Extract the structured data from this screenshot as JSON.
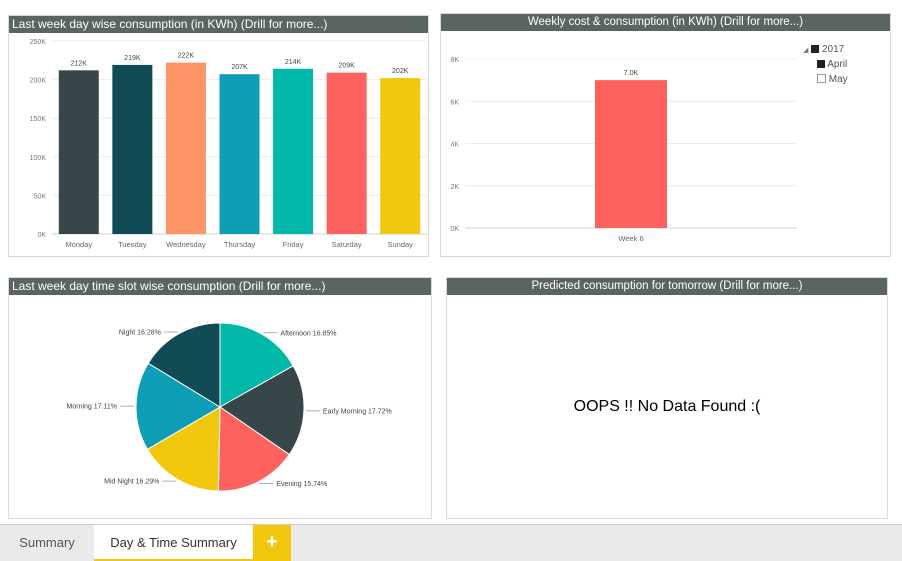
{
  "tiles": {
    "day_wise": {
      "title": "Last week day wise consumption (in KWh) (Drill for more...)",
      "chart_data": {
        "type": "bar",
        "categories": [
          "Monday",
          "Tuesday",
          "Wednesday",
          "Thursday",
          "Friday",
          "Saturday",
          "Sunday"
        ],
        "values": [
          212000,
          219000,
          222000,
          207000,
          214000,
          209000,
          202000
        ],
        "data_labels": [
          "212K",
          "219K",
          "222K",
          "207K",
          "214K",
          "209K",
          "202K"
        ],
        "colors": [
          "#374649",
          "#114b56",
          "#fd9567",
          "#0d9eb5",
          "#01b8aa",
          "#fd625e",
          "#f2c80f"
        ],
        "ylim": [
          0,
          250000
        ],
        "yticks": [
          0,
          50000,
          100000,
          150000,
          200000,
          250000
        ],
        "ytick_labels": [
          "0K",
          "50K",
          "100K",
          "150K",
          "200K",
          "250K"
        ],
        "grid": true
      }
    },
    "weekly_cost": {
      "title": "Weekly cost & consumption (in KWh) (Drill for more...)",
      "chart_data": {
        "type": "bar",
        "categories": [
          "Week 6"
        ],
        "values": [
          7000
        ],
        "data_labels": [
          "7.0K"
        ],
        "colors": [
          "#fd625e"
        ],
        "ylim": [
          0,
          8000
        ],
        "yticks": [
          0,
          2000,
          4000,
          6000,
          8000
        ],
        "ytick_labels": [
          "0K",
          "2K",
          "4K",
          "6K",
          "8K"
        ],
        "grid": true
      },
      "legend": {
        "year": "2017",
        "items": [
          {
            "label": "April",
            "checked": true
          },
          {
            "label": "May",
            "checked": false
          }
        ]
      }
    },
    "time_slot": {
      "title": "Last week day time slot wise consumption (Drill for more...)",
      "chart_data": {
        "type": "pie",
        "categories": [
          "Afternoon",
          "Early Morning",
          "Evening",
          "Mid Night",
          "Morning",
          "Night"
        ],
        "values": [
          16.85,
          17.72,
          15.74,
          16.29,
          17.11,
          16.28
        ],
        "labels": [
          "Afternoon 16.85%",
          "Early Morning 17.72%",
          "Evening 15.74%",
          "Mid Night 16.29%",
          "Morning 17.11%",
          "Night 16.28%"
        ],
        "colors": [
          "#01b8aa",
          "#374649",
          "#fd625e",
          "#f2c80f",
          "#0d9eb5",
          "#114b56"
        ]
      }
    },
    "predicted": {
      "title": "Predicted consumption for tomorrow (Drill for more...)",
      "message": "OOPS !! No Data Found :("
    }
  },
  "tabs": [
    {
      "label": "Summary",
      "active": false
    },
    {
      "label": "Day & Time Summary",
      "active": true
    }
  ],
  "add_tab": "+"
}
